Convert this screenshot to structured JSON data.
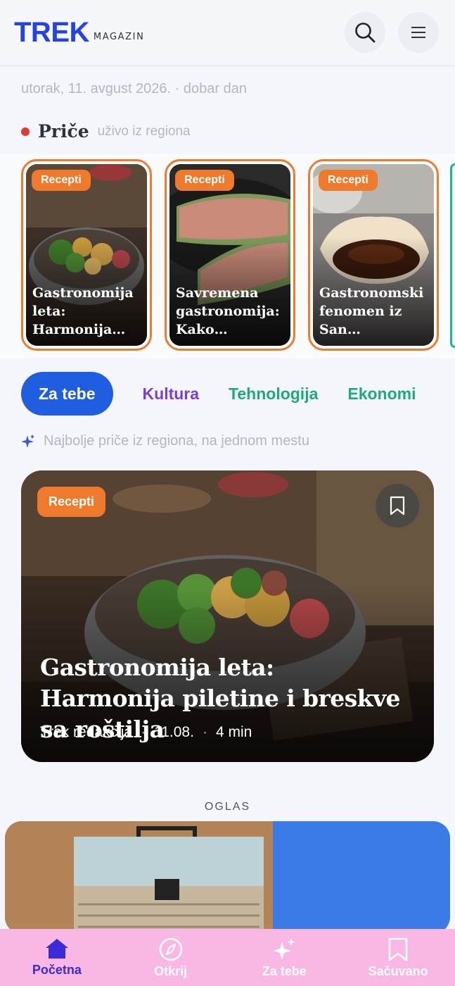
{
  "header": {
    "logo_main": "TREK",
    "logo_sub": "MAGAZIN",
    "search_icon": "search-icon",
    "menu_icon": "hamburger-icon"
  },
  "dateline": "utorak, 11. avgust 2026. · dobar dan",
  "stories": {
    "title": "Priče",
    "subtitle": "uživo iz regiona",
    "items": [
      {
        "badge": "Recepti",
        "title": "Gastronomija leta: Harmonija…"
      },
      {
        "badge": "Recepti",
        "title": "Savremena gastronomija: Kako…"
      },
      {
        "badge": "Recepti",
        "title": "Gastronomski fenomen iz San…"
      }
    ]
  },
  "tabs": [
    {
      "label": "Za tebe",
      "color": "#ffffff"
    },
    {
      "label": "Kultura",
      "color": "#7b3fd0"
    },
    {
      "label": "Tehnologija",
      "color": "#1faa7a"
    },
    {
      "label": "Ekonomi",
      "color": "#1faa7a"
    }
  ],
  "tagline": "Najbolje priče iz regiona, na jednom mestu",
  "hero": {
    "badge": "Recepti",
    "title": "Gastronomija leta: Harmonija piletine i breskve sa roštilja",
    "author": "Trek redakcija",
    "date": "11.08.",
    "read_time": "4 min"
  },
  "ad": {
    "label": "OGLAS"
  },
  "bottom_nav": [
    {
      "label": "Početna",
      "icon": "home-icon"
    },
    {
      "label": "Otkrij",
      "icon": "compass-icon"
    },
    {
      "label": "Za tebe",
      "icon": "sparkle-icon"
    },
    {
      "label": "Sačuvano",
      "icon": "bookmark-icon"
    }
  ],
  "colors": {
    "brand": "#2443e6",
    "accent_orange": "#f07a2c",
    "tab_active": "#1f5ee0",
    "nav_bg": "#f9b7e3"
  }
}
